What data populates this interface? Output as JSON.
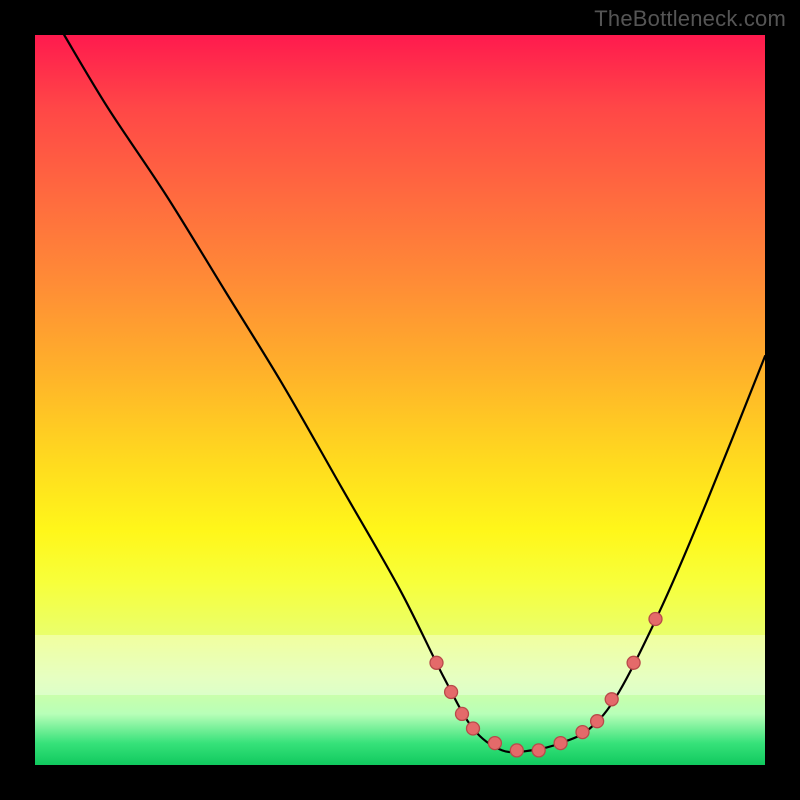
{
  "attribution": "TheBottleneck.com",
  "chart_data": {
    "type": "line",
    "title": "",
    "xlabel": "",
    "ylabel": "",
    "xlim": [
      0,
      100
    ],
    "ylim": [
      0,
      100
    ],
    "grid": false,
    "legend": false,
    "background_gradient": {
      "top": "#ff1a4e",
      "mid": "#ffd91f",
      "bottom": "#10c95e"
    },
    "series": [
      {
        "name": "bottleneck-curve",
        "x": [
          4,
          10,
          18,
          26,
          34,
          42,
          50,
          56,
          60,
          64,
          68,
          72,
          76,
          80,
          86,
          92,
          100
        ],
        "y": [
          100,
          90,
          78,
          65,
          52,
          38,
          24,
          12,
          5,
          2,
          2,
          3,
          5,
          10,
          22,
          36,
          56
        ]
      }
    ],
    "markers": {
      "name": "highlight-dots",
      "x": [
        55,
        57,
        58.5,
        60,
        63,
        66,
        69,
        72,
        75,
        77,
        79,
        82,
        85
      ],
      "y": [
        14,
        10,
        7,
        5,
        3,
        2,
        2,
        3,
        4.5,
        6,
        9,
        14,
        20
      ]
    }
  }
}
